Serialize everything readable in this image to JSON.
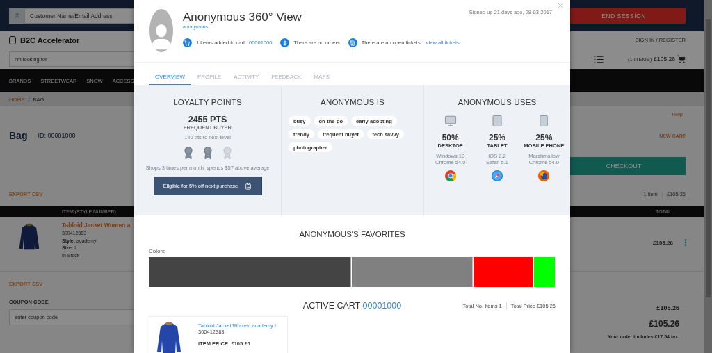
{
  "background_page": {
    "customer_search": {
      "placeholder": "Customer Name/Email Address"
    },
    "end_session_button": "END SESSION",
    "logo": "B2C Accelerator",
    "sign_in_link": "SIGN IN / REGISTER",
    "product_search": {
      "placeholder": "I'm looking for"
    },
    "mini_cart": {
      "count": "(1 ITEMS)",
      "total": "£105.26"
    },
    "nav_items": [
      "BRANDS",
      "STREETWEAR",
      "SNOW",
      "ACCESS"
    ],
    "breadcrumb": {
      "items": [
        "HOME",
        "BAG"
      ],
      "separator": "/"
    },
    "help_link": "Help",
    "bag_title": "Bag",
    "bag_id": "ID: 00001000",
    "new_cart_link": "NEW CART",
    "checkout_button": "CHECKOUT",
    "export_csv_top": "EXPORT CSV",
    "cart_summary": {
      "items": "1 item",
      "total": "£105.26"
    },
    "table": {
      "columns": [
        "ITEM (STYLE NUMBER)",
        "TOTAL"
      ],
      "rows": [
        {
          "name": "Tabloid Jacket Women a",
          "style_number": "300412383",
          "style": "**Style:** academy",
          "size": "**Size:** L",
          "stock": "In Stock",
          "total": "£105.26"
        }
      ]
    },
    "export_csv_bottom": "EXPORT CSV",
    "coupon": {
      "label": "COUPON CODE",
      "placeholder": "enter coupon code"
    },
    "totals": {
      "subtotal": "£105.26",
      "total": "£105.26",
      "tax_note": "Your order includes £17.54 tax."
    }
  },
  "modal": {
    "title": "Anonymous 360° View",
    "subtitle": "anonymous",
    "signed_up": "Signed up 21 days ago, 28-03-2017",
    "stats": [
      {
        "kind": "cart",
        "text": "1 items added to cart",
        "link": "00001000"
      },
      {
        "kind": "orders",
        "text": "There are no orders"
      },
      {
        "kind": "tickets",
        "text": "There are no open tickets.",
        "link": "view all tickets"
      }
    ],
    "tabs": [
      {
        "label": "OVERVIEW",
        "selected": true
      },
      {
        "label": "PROFILE",
        "selected": false
      },
      {
        "label": "ACTIVITY",
        "selected": false
      },
      {
        "label": "FEEDBACK",
        "selected": false
      },
      {
        "label": "MAPS",
        "selected": false
      }
    ],
    "loyalty": {
      "title": "LOYALTY POINTS",
      "points": "2455 PTS",
      "tier": "FREQUENT BUYER",
      "next_level": "140 pts to next level",
      "stars": 2,
      "summary": "Shops 3 times per month, spends $57 above average",
      "offer_button": "Eligible for 5% off next purchase"
    },
    "traits": {
      "title": "ANONYMOUS IS",
      "tags": [
        "busy",
        "on-the-go",
        "early-adopting",
        "trendy",
        "frequent buyer",
        "tech savvy",
        "photographer"
      ]
    },
    "devices": {
      "title": "ANONYMOUS USES",
      "items": [
        {
          "kind": "desktop",
          "share": "50%",
          "name": "DESKTOP",
          "os": "Windows 10",
          "browser": "Chrome 54.0",
          "browser_logo": {
            "kind": "chrome"
          }
        },
        {
          "kind": "tablet",
          "share": "25%",
          "name": "TABLET",
          "os": "IOS 8.2",
          "browser": "Safari 5.1",
          "browser_logo": {
            "kind": "safari"
          }
        },
        {
          "kind": "mobile",
          "share": "25%",
          "name": "MOBILE PHONE",
          "os": "Marshmallow",
          "browser": "Chrome 54.0",
          "browser_logo": {
            "kind": "firefox"
          }
        }
      ]
    },
    "favorites": {
      "title": "ANONYMOUS'S FAVORITES",
      "colors_label": "Colors",
      "colors": [
        {
          "color": "#444444"
        },
        {
          "color": "#808080"
        },
        {
          "color": "#ff0000"
        },
        {
          "color": "#00ff00"
        }
      ]
    },
    "active_cart": {
      "title": "ACTIVE CART",
      "cart_id": "00001000",
      "items_total": "Total No. Items 1",
      "price_total": "Total Price £105.26",
      "items": [
        {
          "name": "Tabloid Jacket Women academy L",
          "style_number": "300412383",
          "price": "ITEM PRICE: £105.26"
        }
      ]
    }
  }
}
